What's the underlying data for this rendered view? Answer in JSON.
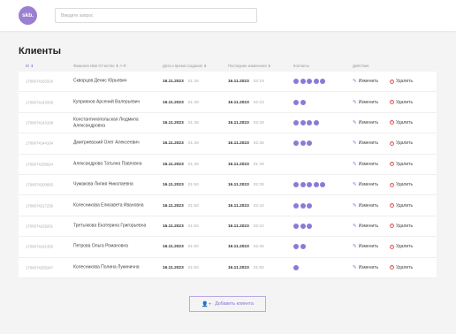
{
  "header": {
    "logo_text": "skb.",
    "search_placeholder": "Введите запрос"
  },
  "page_title": "Клиенты",
  "columns": {
    "id": "ID ⬇",
    "name": "Фамилия Имя Отчество ⬆ А-Я",
    "created": "Дата и время создания ⬇",
    "updated": "Последние изменения ⬇",
    "contacts": "Контакты",
    "actions": "Действия"
  },
  "actions": {
    "edit_label": "Изменить",
    "delete_label": "Удалить"
  },
  "rows": [
    {
      "id": "1700074163316",
      "name": "Скворцов Денис Юрьевич",
      "created_date": "16.11.2023",
      "created_time": "01:48",
      "updated_date": "16.11.2023",
      "updated_time": "02:19",
      "contacts": 5
    },
    {
      "id": "1700074143336",
      "name": "Куприянов Арсений Валерьевич",
      "created_date": "16.11.2023",
      "created_time": "01:48",
      "updated_date": "16.11.2023",
      "updated_time": "02:23",
      "contacts": 2
    },
    {
      "id": "1700074143108",
      "name": "Константинопольская Людмила Александровна",
      "created_date": "16.11.2023",
      "created_time": "01:48",
      "updated_date": "16.11.2023",
      "updated_time": "02:29",
      "contacts": 4
    },
    {
      "id": "1700074144104",
      "name": "Дмитриевский Олег Алексеевич",
      "created_date": "16.11.2023",
      "created_time": "01:49",
      "updated_date": "16.11.2023",
      "updated_time": "02:36",
      "contacts": 3
    },
    {
      "id": "1700074155024",
      "name": "Александрова Татьяна Павловна",
      "created_date": "16.11.2023",
      "created_time": "01:49",
      "updated_date": "16.11.2023",
      "updated_time": "01:49",
      "contacts": 0
    },
    {
      "id": "1700074200665",
      "name": "Чумакова Лилия Николаевна",
      "created_date": "16.11.2023",
      "created_time": "01:50",
      "updated_date": "16.11.2023",
      "updated_time": "02:39",
      "contacts": 5
    },
    {
      "id": "1700074217236",
      "name": "Колесникова Елизавета Ивановна",
      "created_date": "16.11.2023",
      "created_time": "01:50",
      "updated_date": "16.11.2023",
      "updated_time": "02:44",
      "contacts": 3
    },
    {
      "id": "1700074229201",
      "name": "Третьякова Екатерина Григорьевна",
      "created_date": "16.11.2023",
      "created_time": "01:50",
      "updated_date": "16.11.2023",
      "updated_time": "02:24",
      "contacts": 3
    },
    {
      "id": "1700074241355",
      "name": "Петрова Ольга Романовна",
      "created_date": "16.11.2023",
      "created_time": "01:50",
      "updated_date": "16.11.2023",
      "updated_time": "02:36",
      "contacts": 2
    },
    {
      "id": "1700074255347",
      "name": "Колесникова Полина Лукинична",
      "created_date": "16.11.2023",
      "created_time": "01:50",
      "updated_date": "16.11.2023",
      "updated_time": "01:55",
      "contacts": 1
    }
  ],
  "add_button_label": "Добавить клиента",
  "colors": {
    "accent": "#9873ff",
    "delete": "#f06a4d"
  }
}
